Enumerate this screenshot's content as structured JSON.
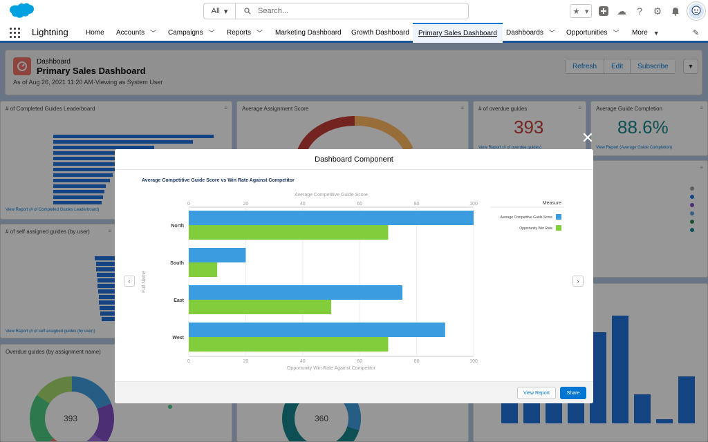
{
  "colors": {
    "brand": "#0176d3",
    "nav_bar": "#1b5297",
    "series_blue": "#3c9ce0",
    "series_green": "#82cd3b",
    "overdue_red": "#c23934",
    "completion_teal": "#12838b"
  },
  "global_header": {
    "search_scope": "All",
    "search_placeholder": "Search..."
  },
  "nav": {
    "app_name": "Lightning",
    "items": [
      {
        "label": "Home"
      },
      {
        "label": "Accounts"
      },
      {
        "label": "Campaigns"
      },
      {
        "label": "Reports"
      },
      {
        "label": "Marketing Dashboard"
      },
      {
        "label": "Growth Dashboard"
      },
      {
        "label": "Primary Sales Dashboard"
      },
      {
        "label": "Dashboards"
      },
      {
        "label": "Opportunities"
      },
      {
        "label": "More"
      }
    ]
  },
  "page_header": {
    "object_type": "Dashboard",
    "title": "Primary Sales Dashboard",
    "subtitle": "As of Aug 26, 2021 11:20 AM·Viewing as System User",
    "buttons": {
      "refresh": "Refresh",
      "edit": "Edit",
      "subscribe": "Subscribe"
    }
  },
  "background_cards": {
    "leaderboard": {
      "title": "# of Completed Guides Leaderboard",
      "link": "View Report (# of Completed Guides Leaderboard)"
    },
    "assignment_score": {
      "title": "Average Assignment Score"
    },
    "overdue": {
      "title": "# of overdue guides",
      "value": "393",
      "link": "View Report (# of overdue guides)"
    },
    "completion": {
      "title": "Average Guide Completion",
      "value": "88.6%",
      "link": "View Report (Average Guide Completion)"
    },
    "self_assigned": {
      "title": "# of self assigned guides (by user)",
      "link": "View Report (# of self assigned guides (by user))"
    },
    "overdue_by_name": {
      "title": "Overdue guides (by assignment name)",
      "donut_value": "393"
    },
    "center_donut": {
      "value": "360"
    }
  },
  "modal": {
    "header": "Dashboard Component",
    "footer": {
      "view_report": "View Report",
      "share": "Share"
    }
  },
  "chart_data": {
    "type": "bar",
    "orientation": "horizontal",
    "title": "Average Competitive Guide Score vs Win Rate Against Competitor",
    "top_axis_label": "Average Competitive Guide Score",
    "bottom_axis_label": "Opportunity Win Rate Against Competitor",
    "ylabel": "Full Name",
    "xlim": [
      0,
      100
    ],
    "ticks": [
      0,
      20,
      40,
      60,
      80,
      100
    ],
    "grid": true,
    "legend_position": "right",
    "legend_title": "Measure",
    "categories": [
      "North",
      "South",
      "East",
      "West"
    ],
    "series": [
      {
        "name": "Average Competitive Guide Score",
        "color": "#3c9ce0",
        "values": [
          100,
          20,
          75,
          90
        ]
      },
      {
        "name": "Opportunity Win Rate",
        "color": "#82cd3b",
        "values": [
          70,
          10,
          50,
          70
        ]
      }
    ]
  }
}
